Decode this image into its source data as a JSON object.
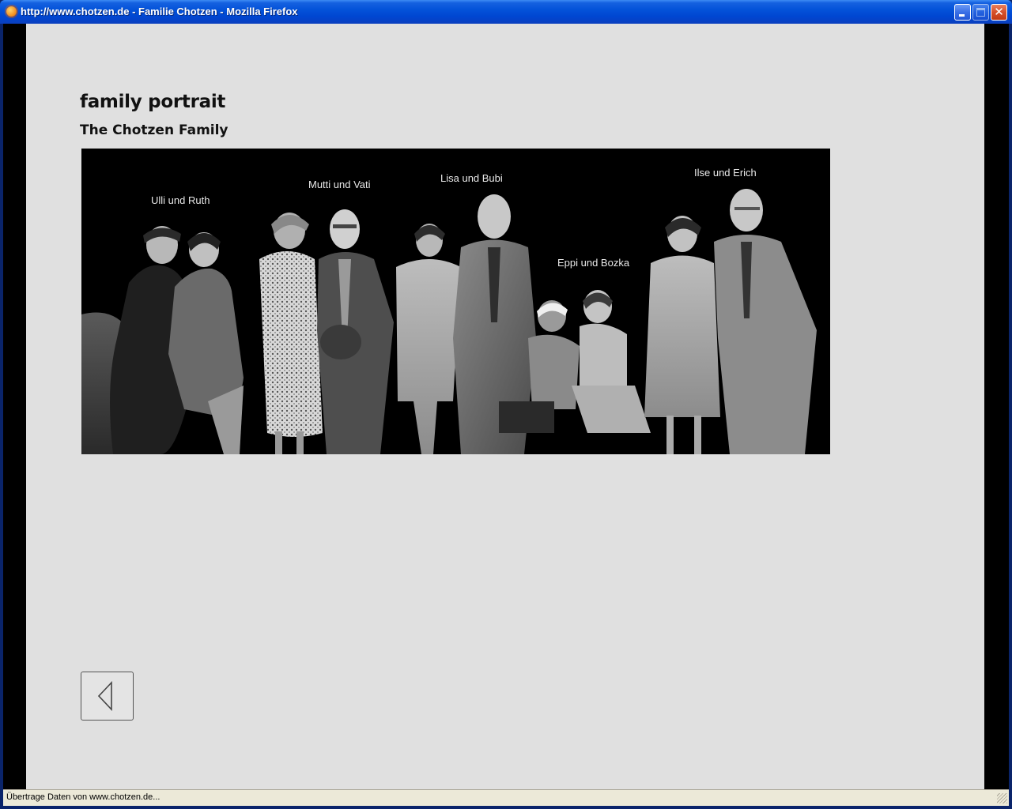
{
  "window": {
    "title": "http://www.chotzen.de - Familie Chotzen - Mozilla Firefox",
    "icon": "firefox-icon"
  },
  "page": {
    "heading": "family portrait",
    "subheading": "The Chotzen Family",
    "photo_captions": [
      "Ulli und Ruth",
      "Mutti und Vati",
      "Lisa und Bubi",
      "Eppi und Bozka",
      "Ilse und Erich"
    ],
    "back_button_icon": "back-arrow-icon"
  },
  "statusbar": {
    "text": "Übertrage Daten von www.chotzen.de..."
  },
  "colors": {
    "page_background": "#e0e0e0",
    "photo_background": "#000000",
    "titlebar_blue": "#0453d9"
  }
}
